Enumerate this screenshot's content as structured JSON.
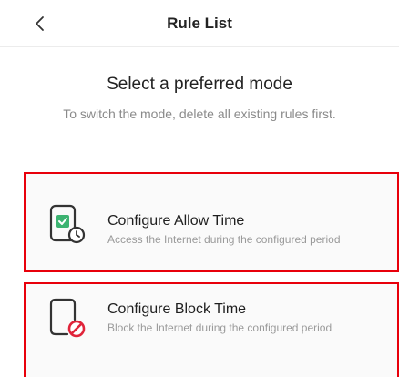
{
  "header": {
    "title": "Rule List",
    "back_icon": "chevron-left-icon"
  },
  "main": {
    "heading": "Select a preferred mode",
    "subheading": "To switch the mode, delete all existing rules first."
  },
  "options": [
    {
      "title": "Configure Allow Time",
      "description": "Access the Internet during the configured period",
      "icon": "phone-check-icon",
      "accent": "#3cb371"
    },
    {
      "title": "Configure Block Time",
      "description": "Block the Internet during the configured period",
      "icon": "phone-block-icon",
      "accent": "#e0243a"
    }
  ],
  "colors": {
    "highlight": "#e8000b",
    "text_primary": "#1f1f1f",
    "text_secondary": "#8a8a8a"
  }
}
